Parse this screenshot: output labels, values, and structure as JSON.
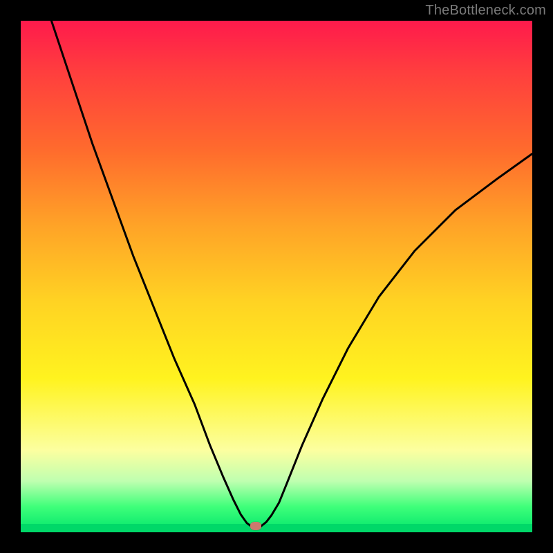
{
  "watermark": "TheBottleneck.com",
  "chart_data": {
    "type": "line",
    "title": "",
    "xlabel": "",
    "ylabel": "",
    "xlim": [
      0,
      100
    ],
    "ylim": [
      0,
      100
    ],
    "series": [
      {
        "name": "bottleneck-curve",
        "x": [
          6,
          10,
          14,
          18,
          22,
          26,
          30,
          34,
          37,
          39.5,
          41.5,
          43,
          44.2,
          45,
          46,
          47,
          48,
          49,
          50.5,
          52,
          55,
          59,
          64,
          70,
          77,
          85,
          93,
          100
        ],
        "y": [
          100,
          88,
          76,
          65,
          54,
          44,
          34,
          25,
          17,
          11,
          6.5,
          3.5,
          1.8,
          1.2,
          1.2,
          1.2,
          2,
          3.3,
          5.8,
          9.5,
          17,
          26,
          36,
          46,
          55,
          63,
          69,
          74
        ]
      }
    ],
    "marker": {
      "x": 46,
      "y": 1.2,
      "color": "#cc7a6e"
    },
    "background_gradient_stops": [
      {
        "pos": 0,
        "color": "#ff1a4c"
      },
      {
        "pos": 10,
        "color": "#ff3e3e"
      },
      {
        "pos": 25,
        "color": "#ff6a2d"
      },
      {
        "pos": 40,
        "color": "#ffa327"
      },
      {
        "pos": 55,
        "color": "#ffd323"
      },
      {
        "pos": 70,
        "color": "#fff31f"
      },
      {
        "pos": 84,
        "color": "#fcffa0"
      },
      {
        "pos": 90,
        "color": "#bfffb0"
      },
      {
        "pos": 95,
        "color": "#3fff7a"
      },
      {
        "pos": 100,
        "color": "#00e56b"
      }
    ]
  }
}
